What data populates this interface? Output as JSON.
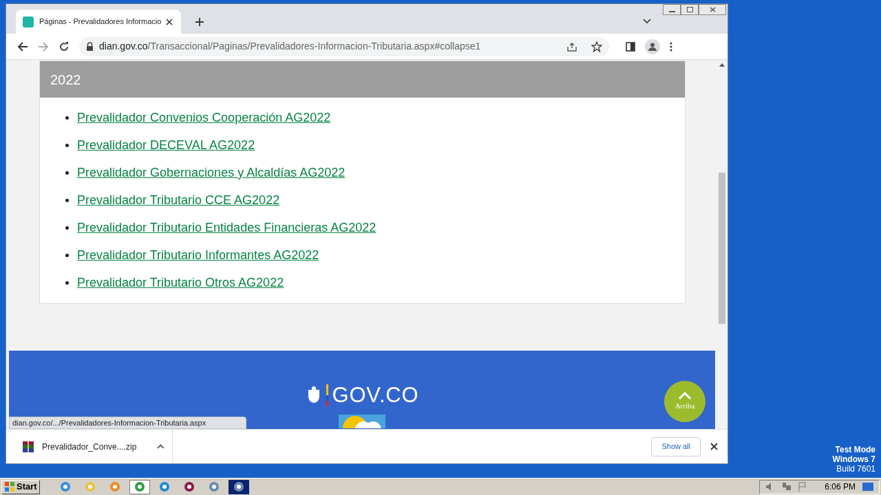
{
  "browser": {
    "tab": {
      "title": "Páginas - Prevalidadores Informacio",
      "selected": true
    },
    "url_host": "dian.gov.co",
    "url_path": "/Transaccional/Paginas/Prevalidadores-Informacion-Tributaria.aspx#collapse1"
  },
  "accordion": {
    "title": "2022",
    "expanded": true,
    "links": [
      "Prevalidador Convenios Cooperación AG2022",
      "Prevalidador DECEVAL AG2022",
      "Prevalidador Gobernaciones y Alcaldías AG2022",
      "Prevalidador Tributario CCE AG2022",
      "Prevalidador Tributario Entidades Financieras AG2022",
      "Prevalidador Tributario Informantes AG2022",
      "Prevalidador Tributario Otros AG2022"
    ]
  },
  "footer": {
    "logo_text": "GOV.CO"
  },
  "back_to_top": "Arriba",
  "status_url": "dian.gov.co/.../Prevalidadores-Informacion-Tributaria.aspx",
  "downloads": {
    "file": "Prevalidador_Conve....zip",
    "show_all": "Show all"
  },
  "desktop": {
    "watermark_lines": [
      "Test Mode",
      "Windows 7",
      "Build 7601"
    ]
  },
  "taskbar": {
    "start": "Start",
    "clock": "6:06 PM"
  }
}
